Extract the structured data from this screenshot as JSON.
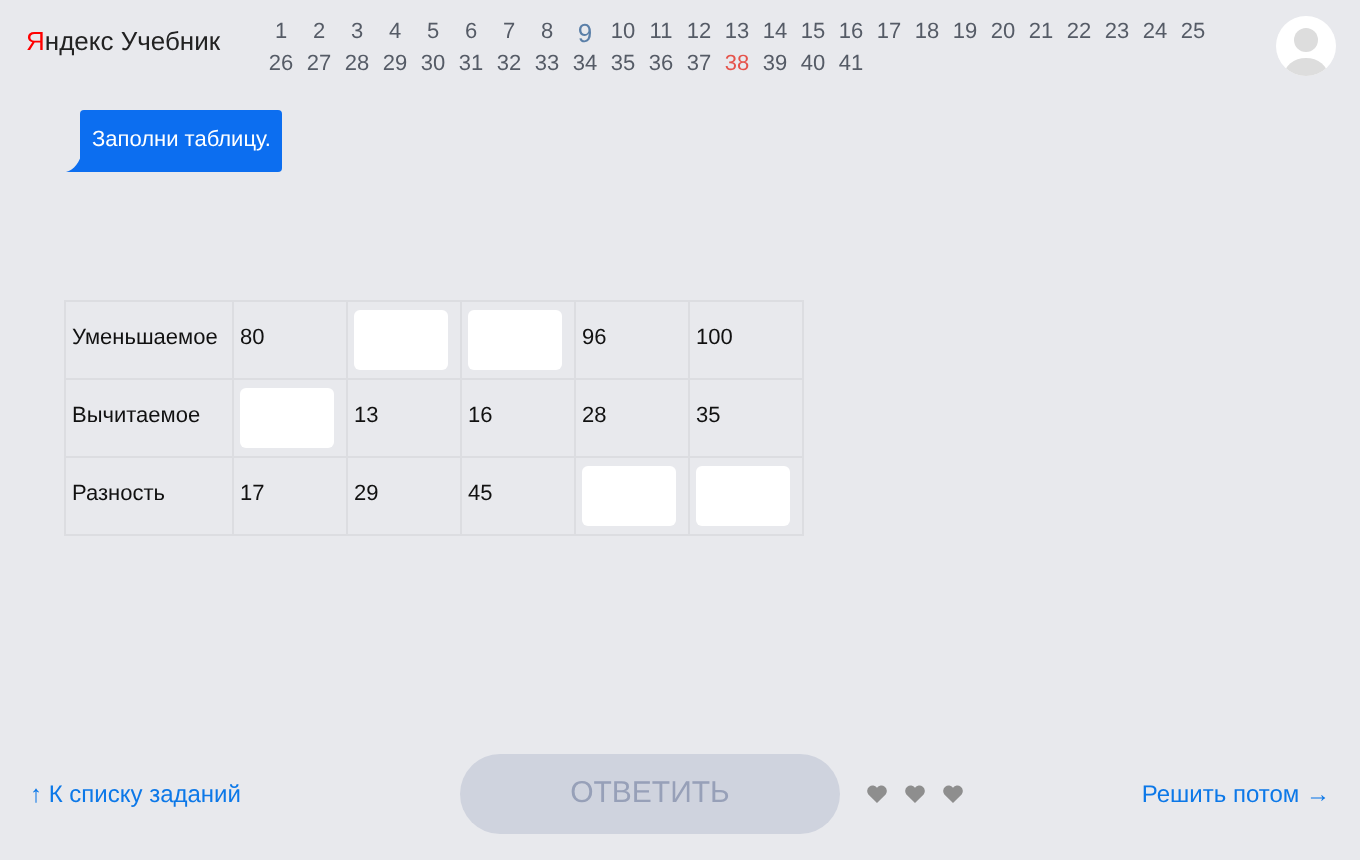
{
  "header": {
    "logo": {
      "brand": "Яндекс",
      "product": "Учебник"
    },
    "tasks": [
      {
        "label": "1",
        "current": false,
        "error": false
      },
      {
        "label": "2",
        "current": false,
        "error": false
      },
      {
        "label": "3",
        "current": false,
        "error": false
      },
      {
        "label": "4",
        "current": false,
        "error": false
      },
      {
        "label": "5",
        "current": false,
        "error": false
      },
      {
        "label": "6",
        "current": false,
        "error": false
      },
      {
        "label": "7",
        "current": false,
        "error": false
      },
      {
        "label": "8",
        "current": false,
        "error": false
      },
      {
        "label": "9",
        "current": true,
        "error": false
      },
      {
        "label": "10",
        "current": false,
        "error": false
      },
      {
        "label": "11",
        "current": false,
        "error": false
      },
      {
        "label": "12",
        "current": false,
        "error": false
      },
      {
        "label": "13",
        "current": false,
        "error": false
      },
      {
        "label": "14",
        "current": false,
        "error": false
      },
      {
        "label": "15",
        "current": false,
        "error": false
      },
      {
        "label": "16",
        "current": false,
        "error": false
      },
      {
        "label": "17",
        "current": false,
        "error": false
      },
      {
        "label": "18",
        "current": false,
        "error": false
      },
      {
        "label": "19",
        "current": false,
        "error": false
      },
      {
        "label": "20",
        "current": false,
        "error": false
      },
      {
        "label": "21",
        "current": false,
        "error": false
      },
      {
        "label": "22",
        "current": false,
        "error": false
      },
      {
        "label": "23",
        "current": false,
        "error": false
      },
      {
        "label": "24",
        "current": false,
        "error": false
      },
      {
        "label": "25",
        "current": false,
        "error": false
      },
      {
        "label": "26",
        "current": false,
        "error": false
      },
      {
        "label": "27",
        "current": false,
        "error": false
      },
      {
        "label": "28",
        "current": false,
        "error": false
      },
      {
        "label": "29",
        "current": false,
        "error": false
      },
      {
        "label": "30",
        "current": false,
        "error": false
      },
      {
        "label": "31",
        "current": false,
        "error": false
      },
      {
        "label": "32",
        "current": false,
        "error": false
      },
      {
        "label": "33",
        "current": false,
        "error": false
      },
      {
        "label": "34",
        "current": false,
        "error": false
      },
      {
        "label": "35",
        "current": false,
        "error": false
      },
      {
        "label": "36",
        "current": false,
        "error": false
      },
      {
        "label": "37",
        "current": false,
        "error": false
      },
      {
        "label": "38",
        "current": false,
        "error": true
      },
      {
        "label": "39",
        "current": false,
        "error": false
      },
      {
        "label": "40",
        "current": false,
        "error": false
      },
      {
        "label": "41",
        "current": false,
        "error": false
      }
    ]
  },
  "instruction": "Заполни таблицу.",
  "table": {
    "rows": [
      {
        "label": "Уменьшаемое",
        "cells": [
          {
            "kind": "text",
            "text": "80"
          },
          {
            "kind": "input"
          },
          {
            "kind": "input"
          },
          {
            "kind": "text",
            "text": "96"
          },
          {
            "kind": "text",
            "text": "100"
          }
        ]
      },
      {
        "label": "Вычитаемое",
        "cells": [
          {
            "kind": "input"
          },
          {
            "kind": "text",
            "text": "13"
          },
          {
            "kind": "text",
            "text": "16"
          },
          {
            "kind": "text",
            "text": "28"
          },
          {
            "kind": "text",
            "text": "35"
          }
        ]
      },
      {
        "label": "Разность",
        "cells": [
          {
            "kind": "text",
            "text": "17"
          },
          {
            "kind": "text",
            "text": "29"
          },
          {
            "kind": "text",
            "text": "45"
          },
          {
            "kind": "input"
          },
          {
            "kind": "input"
          }
        ]
      }
    ]
  },
  "footer": {
    "back_link": "↑ К списку заданий",
    "answer_button": {
      "label": "ОТВЕТИТЬ",
      "disabled": true
    },
    "later_link": "Решить потом →"
  }
}
